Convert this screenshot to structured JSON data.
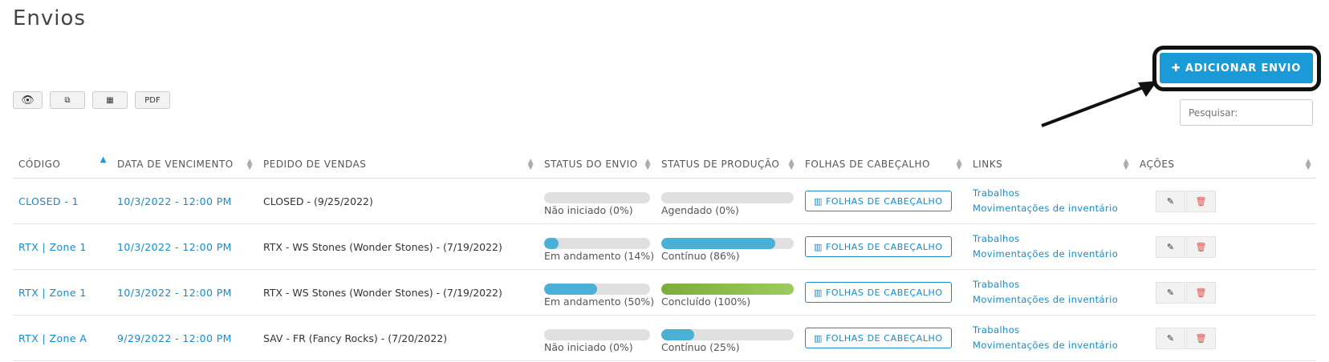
{
  "page": {
    "title": "Envios"
  },
  "toolbar": {
    "view_icon": "👁",
    "copy_icon": "⧉",
    "table_icon": "▦",
    "pdf_label": "PDF"
  },
  "add_button": {
    "label": "✚ ADICIONAR ENVIO"
  },
  "search": {
    "placeholder": "Pesquisar:"
  },
  "columns": [
    "CÓDIGO",
    "DATA DE VENCIMENTO",
    "PEDIDO DE VENDAS",
    "STATUS DO ENVIO",
    "STATUS DE PRODUÇÃO",
    "FOLHAS DE CABEÇALHO",
    "LINKS",
    "AÇÕES"
  ],
  "rows": [
    {
      "code": "CLOSED - 1",
      "due": "10/3/2022 - 12:00 PM",
      "order": "CLOSED - (9/25/2022)",
      "ship_status": "Não iniciado (0%)",
      "ship_pct": 0,
      "prod_status": "Agendado (0%)",
      "prod_pct": 0,
      "prod_color": "blue",
      "folhas": "FOLHAS DE CABEÇALHO",
      "link1": "Trabalhos",
      "link2": "Movimentações de inventário"
    },
    {
      "code": "RTX | Zone 1",
      "due": "10/3/2022 - 12:00 PM",
      "order": "RTX - WS Stones (Wonder Stones) - (7/19/2022)",
      "ship_status": "Em andamento (14%)",
      "ship_pct": 14,
      "prod_status": "Contínuo (86%)",
      "prod_pct": 86,
      "prod_color": "blue",
      "folhas": "FOLHAS DE CABEÇALHO",
      "link1": "Trabalhos",
      "link2": "Movimentações de inventário"
    },
    {
      "code": "RTX | Zone 1",
      "due": "10/3/2022 - 12:00 PM",
      "order": "RTX - WS Stones (Wonder Stones) - (7/19/2022)",
      "ship_status": "Em andamento (50%)",
      "ship_pct": 50,
      "prod_status": "Concluído (100%)",
      "prod_pct": 100,
      "prod_color": "green",
      "folhas": "FOLHAS DE CABEÇALHO",
      "link1": "Trabalhos",
      "link2": "Movimentações de inventário"
    },
    {
      "code": "RTX | Zone A",
      "due": "9/29/2022 - 12:00 PM",
      "order": "SAV - FR (Fancy Rocks) - (7/20/2022)",
      "ship_status": "Não iniciado (0%)",
      "ship_pct": 0,
      "prod_status": "Contínuo (25%)",
      "prod_pct": 25,
      "prod_color": "blue",
      "folhas": "FOLHAS DE CABEÇALHO",
      "link1": "Trabalhos",
      "link2": "Movimentações de inventário"
    }
  ],
  "icons": {
    "edit": "edit-icon",
    "delete": "trash-icon",
    "folhas": "barcode-icon"
  }
}
